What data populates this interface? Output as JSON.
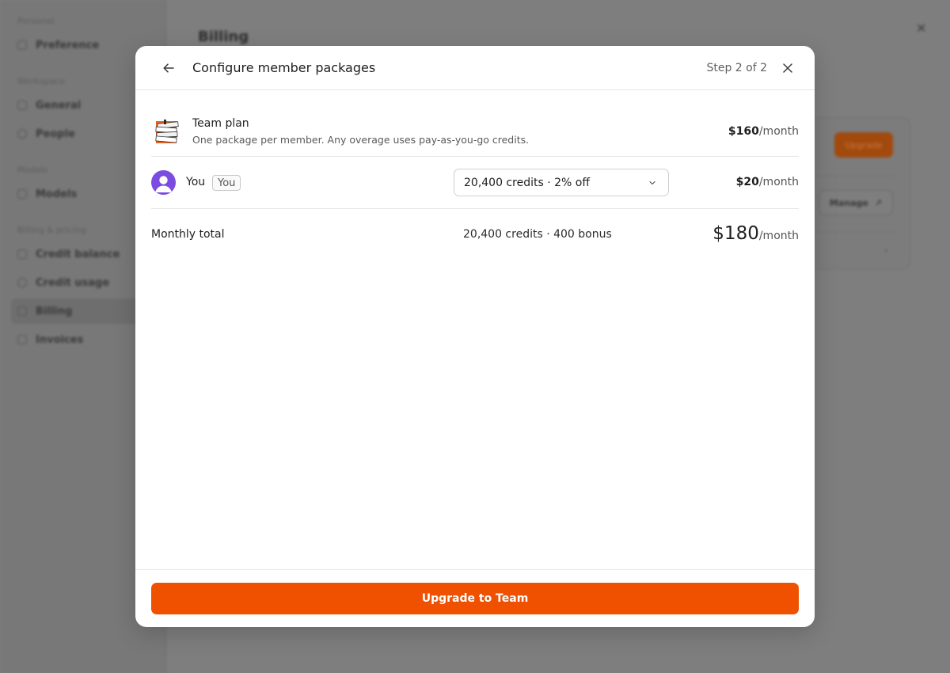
{
  "background": {
    "sidebar": {
      "sections": [
        {
          "label": "Personal",
          "items": [
            {
              "label": "Preference"
            }
          ]
        },
        {
          "label": "Workspace",
          "items": [
            {
              "label": "General"
            },
            {
              "label": "People"
            }
          ]
        },
        {
          "label": "Models",
          "items": [
            {
              "label": "Models"
            }
          ]
        },
        {
          "label": "Billing & pricing",
          "items": [
            {
              "label": "Credit balance"
            },
            {
              "label": "Credit usage"
            },
            {
              "label": "Billing"
            },
            {
              "label": "Invoices"
            }
          ]
        }
      ],
      "active_item": "Billing"
    },
    "page_title": "Billing",
    "upgrade_label": "Upgrade",
    "manage_label": "Manage"
  },
  "modal": {
    "title": "Configure member packages",
    "step_label": "Step 2 of 2",
    "plan": {
      "name": "Team plan",
      "description": "One package per member. Any overage uses pay-as-you-go credits.",
      "price_amount": "$160",
      "price_unit": "/month"
    },
    "member": {
      "name": "You",
      "badge": "You",
      "package_selected": "20,400 credits · 2% off",
      "price_amount": "$20",
      "price_unit": "/month"
    },
    "total": {
      "label": "Monthly total",
      "credits_summary": "20,400 credits · 400 bonus",
      "price_amount": "$180",
      "price_unit": "/month"
    },
    "primary_button_label": "Upgrade to Team"
  },
  "colors": {
    "accent": "#f05100",
    "avatar": "#7b4ce0",
    "overlay": "#7d7d7d"
  },
  "icons": [
    "back-arrow-icon",
    "close-icon",
    "chevron-down-icon",
    "team-plan-icon",
    "user-avatar-icon",
    "external-link-icon"
  ]
}
